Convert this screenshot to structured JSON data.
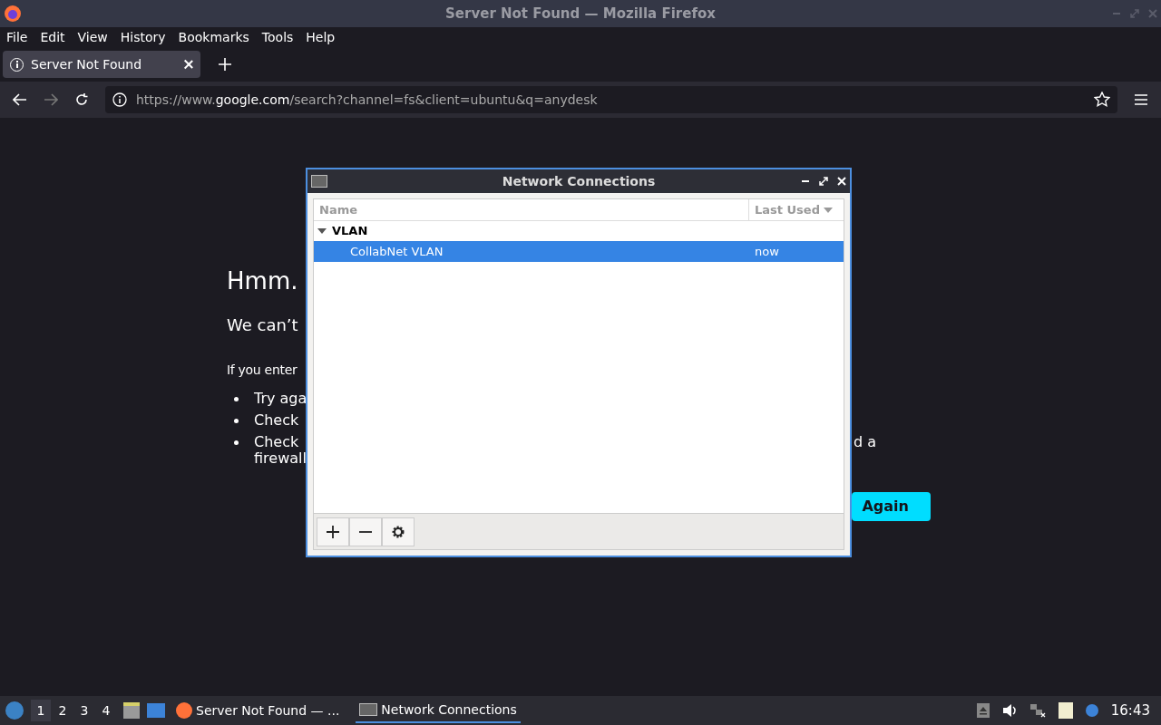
{
  "window": {
    "title": "Server Not Found — Mozilla Firefox"
  },
  "menu_bar": [
    "File",
    "Edit",
    "View",
    "History",
    "Bookmarks",
    "Tools",
    "Help"
  ],
  "tabs": [
    {
      "label": "Server Not Found",
      "selected": true
    }
  ],
  "address_bar": {
    "url_start": "https://www.",
    "url_domain": "google.com",
    "url_rest": "/search?channel=fs&client=ubuntu&q=anydesk"
  },
  "error_page": {
    "heading": "Hmm.",
    "subheading": "We can’t",
    "intro": "If you enter",
    "bullets": [
      {
        "text": "Try aga"
      },
      {
        "text": "Check"
      },
      {
        "text": "Check",
        "tail": "d a",
        "second_line": "firewall"
      }
    ],
    "button": "Again"
  },
  "dialog": {
    "title": "Network Connections",
    "columns": [
      "Name",
      "Last Used"
    ],
    "groups": [
      {
        "name": "VLAN",
        "expanded": true,
        "children": [
          {
            "name": "CollabNet VLAN",
            "last_used": "now",
            "selected": true
          }
        ]
      }
    ],
    "toolbar": [
      {
        "kind": "add"
      },
      {
        "kind": "remove"
      },
      {
        "kind": "settings"
      }
    ]
  },
  "taskbar": {
    "workspaces": [
      {
        "label": "1",
        "selected": true
      },
      {
        "label": "2",
        "selected": false
      },
      {
        "label": "3",
        "selected": false
      },
      {
        "label": "4",
        "selected": false
      }
    ],
    "tasks": [
      {
        "kind": "browser",
        "label": "Server Not Found — ...",
        "selected": false
      },
      {
        "kind": "network",
        "label": "Network Connections",
        "selected": true
      }
    ],
    "clock": "16:43"
  }
}
